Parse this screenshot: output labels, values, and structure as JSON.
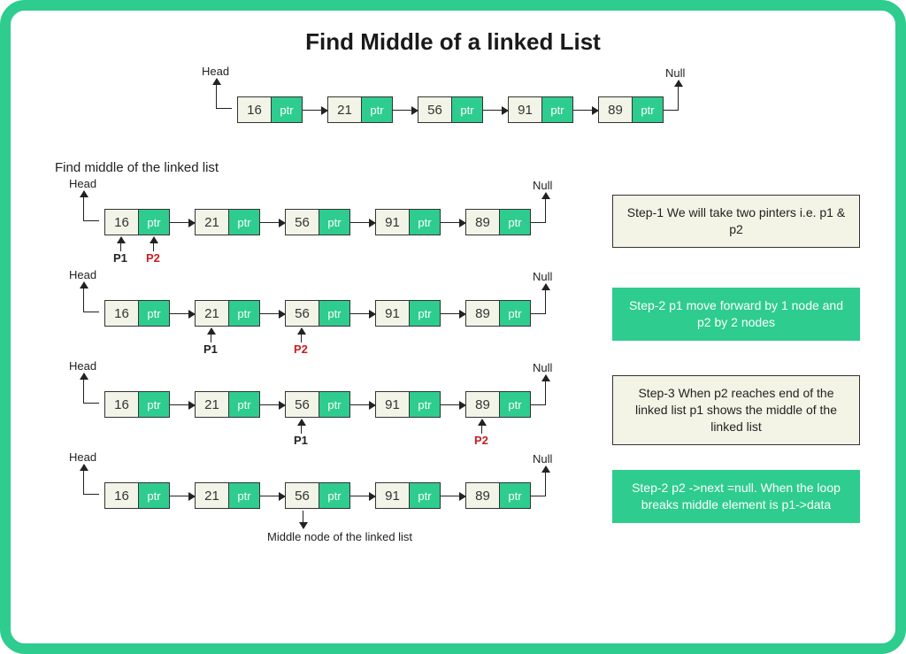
{
  "title": "Find Middle of a linked List",
  "subtitle": "Find middle of the linked list",
  "list_values": [
    "16",
    "21",
    "56",
    "91",
    "89"
  ],
  "ptr_label": "ptr",
  "head_label": "Head",
  "null_label": "Null",
  "pointers": {
    "p1": "P1",
    "p2": "P2"
  },
  "middle_label": "Middle node of the linked list",
  "steps": [
    {
      "style": "beige",
      "text": "Step-1  We will take two pinters i.e. p1 & p2"
    },
    {
      "style": "green",
      "text": "Step-2  p1 move forward by 1 node and p2 by 2 nodes"
    },
    {
      "style": "beige",
      "text": "Step-3  When p2 reaches end of the linked list p1 shows the middle of the linked list"
    },
    {
      "style": "green",
      "text": "Step-2  p2 ->next =null. When the loop breaks middle element is p1->data"
    }
  ],
  "chart_data": {
    "type": "diagram",
    "structure": "singly-linked-list",
    "nodes": [
      16,
      21,
      56,
      91,
      89
    ],
    "algorithm": "two-pointer (slow/fast) to find middle",
    "iterations": [
      {
        "p1_index": 0,
        "p2_index": 0
      },
      {
        "p1_index": 1,
        "p2_index": 2
      },
      {
        "p1_index": 2,
        "p2_index": 4
      },
      {
        "p1_index": 2,
        "p2_index": null,
        "result": "middle = node[2] = 56"
      }
    ]
  }
}
